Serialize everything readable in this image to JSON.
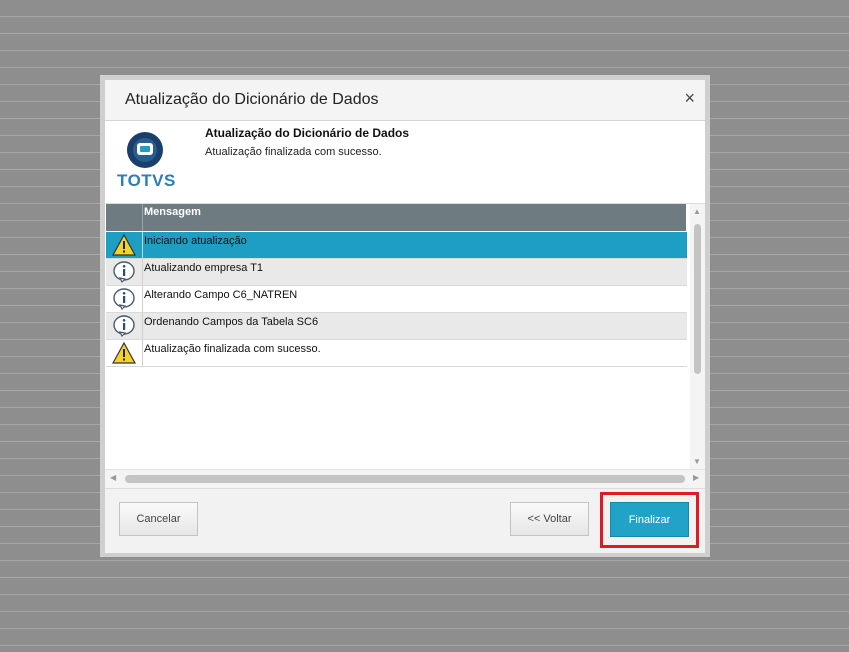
{
  "dialog": {
    "title": "Atualização do Dicionário de Dados",
    "close_icon": "×"
  },
  "header": {
    "logo_text": "TOTVS",
    "title": "Atualização do Dicionário de Dados",
    "subtitle": "Atualização finalizada com sucesso."
  },
  "grid": {
    "column_header": "Mensagem",
    "rows": [
      {
        "icon": "warning-icon",
        "text": "Iniciando atualização"
      },
      {
        "icon": "info-icon",
        "text": "Atualizando empresa T1"
      },
      {
        "icon": "info-icon",
        "text": "Alterando Campo C6_NATREN"
      },
      {
        "icon": "info-icon",
        "text": "Ordenando Campos da Tabela SC6"
      },
      {
        "icon": "warning-icon",
        "text": "Atualização finalizada com sucesso."
      }
    ]
  },
  "footer": {
    "cancel_label": "Cancelar",
    "back_label": "<< Voltar",
    "finish_label": "Finalizar"
  },
  "colors": {
    "accent": "#21a3c8",
    "selected_row": "#1f9ec3",
    "highlight_border": "#e01a22",
    "grid_header": "#6e7b80"
  }
}
